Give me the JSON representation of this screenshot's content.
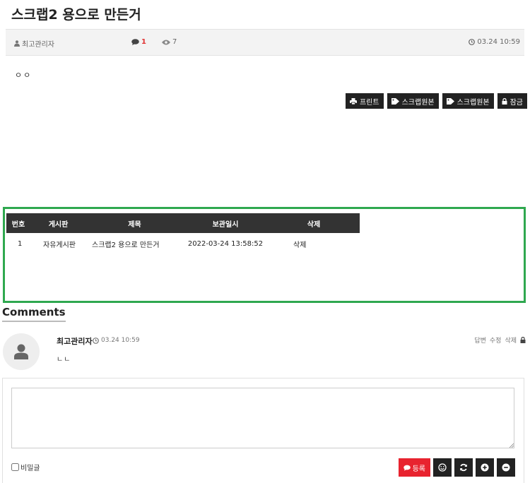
{
  "post": {
    "title": "스크랩2 용으로 만든거",
    "author": "최고관리자",
    "comment_count": "1",
    "view_count": "7",
    "datetime": "03.24 10:59",
    "body": "ㅇㅇ"
  },
  "buttons": {
    "print": "프린트",
    "scrap_original_1": "스크랩원본",
    "scrap_original_2": "스크랩원본",
    "lock": "잠금"
  },
  "scrap_table": {
    "headers": [
      "번호",
      "게시판",
      "제목",
      "보관일시",
      "삭제"
    ],
    "rows": [
      {
        "no": "1",
        "board": "자유게시판",
        "subject": "스크랩2 용으로 만든거",
        "saved_at": "2022-03-24 13:58:52",
        "delete": "삭제"
      }
    ]
  },
  "comments": {
    "heading": "Comments",
    "items": [
      {
        "author": "최고관리자",
        "datetime": "03.24 10:59",
        "text": "ㄴㄴ",
        "reply": "답변",
        "edit": "수정",
        "delete": "삭제"
      }
    ]
  },
  "comment_form": {
    "textarea_value": "",
    "secret_label": "비밀글",
    "submit_label": "등록"
  },
  "colors": {
    "accent_red": "#e8232f",
    "dark": "#222222",
    "highlight_green": "#2fa84f"
  }
}
